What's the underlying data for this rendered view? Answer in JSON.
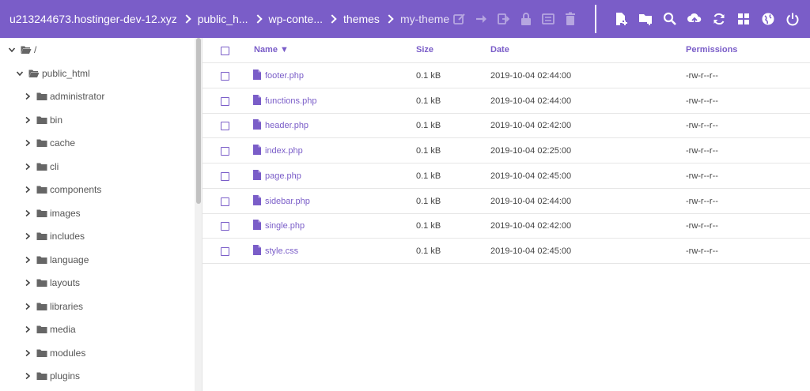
{
  "app": {
    "accent": "#7a5dc8"
  },
  "breadcrumb": [
    "u213244673.hostinger-dev-12.xyz",
    "public_h...",
    "wp-conte...",
    "themes",
    "my-theme"
  ],
  "toolbar": {
    "file_actions": [
      "edit-icon",
      "move-icon",
      "rename-icon",
      "permissions-icon",
      "archive-icon",
      "delete-icon"
    ],
    "global_actions": [
      "new-file-icon",
      "new-folder-icon",
      "search-icon",
      "upload-icon",
      "refresh-icon",
      "layout-icon",
      "globe-icon",
      "logout-icon"
    ]
  },
  "tree": {
    "root": "/",
    "public_html": "public_html",
    "folders": [
      "administrator",
      "bin",
      "cache",
      "cli",
      "components",
      "images",
      "includes",
      "language",
      "layouts",
      "libraries",
      "media",
      "modules",
      "plugins"
    ]
  },
  "table": {
    "headers": {
      "name": "Name ▼",
      "size": "Size",
      "date": "Date",
      "permissions": "Permissions"
    },
    "rows": [
      {
        "name": "footer.php",
        "size": "0.1 kB",
        "date": "2019-10-04 02:44:00",
        "perms": "-rw-r--r--"
      },
      {
        "name": "functions.php",
        "size": "0.1 kB",
        "date": "2019-10-04 02:44:00",
        "perms": "-rw-r--r--"
      },
      {
        "name": "header.php",
        "size": "0.1 kB",
        "date": "2019-10-04 02:42:00",
        "perms": "-rw-r--r--"
      },
      {
        "name": "index.php",
        "size": "0.1 kB",
        "date": "2019-10-04 02:25:00",
        "perms": "-rw-r--r--"
      },
      {
        "name": "page.php",
        "size": "0.1 kB",
        "date": "2019-10-04 02:45:00",
        "perms": "-rw-r--r--"
      },
      {
        "name": "sidebar.php",
        "size": "0.1 kB",
        "date": "2019-10-04 02:44:00",
        "perms": "-rw-r--r--"
      },
      {
        "name": "single.php",
        "size": "0.1 kB",
        "date": "2019-10-04 02:42:00",
        "perms": "-rw-r--r--"
      },
      {
        "name": "style.css",
        "size": "0.1 kB",
        "date": "2019-10-04 02:45:00",
        "perms": "-rw-r--r--"
      }
    ]
  }
}
